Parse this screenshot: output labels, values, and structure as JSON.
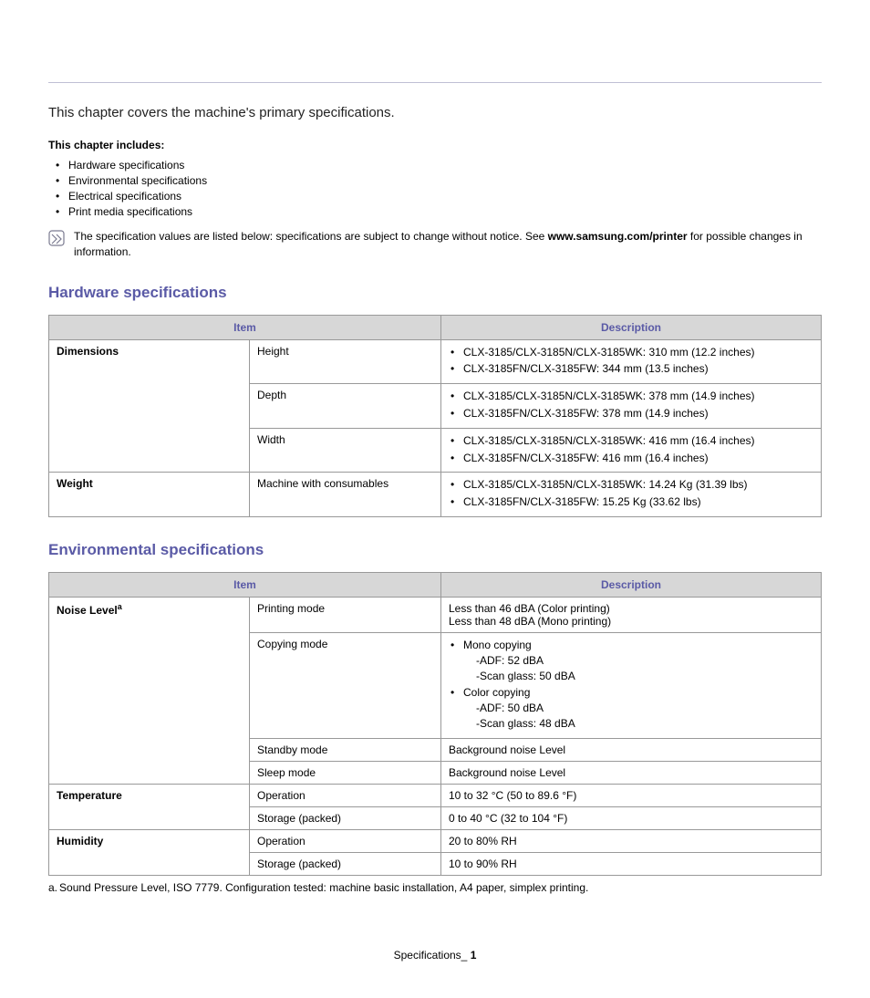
{
  "intro": "This chapter covers the machine's primary specifications.",
  "includes_label": "This chapter includes:",
  "includes": [
    "Hardware specifications",
    "Environmental specifications",
    "Electrical specifications",
    "Print media specifications"
  ],
  "note": {
    "prefix": "The specification values are listed below: specifications are subject to change without notice. See ",
    "link": "www.samsung.com/printer",
    "suffix": " for possible changes in information."
  },
  "table_head": {
    "item": "Item",
    "desc": "Description"
  },
  "hardware": {
    "heading": "Hardware specifications",
    "rows": {
      "dimensions_label": "Dimensions",
      "height_label": "Height",
      "height_v1": "CLX-3185/CLX-3185N/CLX-3185WK: 310 mm (12.2 inches)",
      "height_v2": "CLX-3185FN/CLX-3185FW: 344 mm (13.5 inches)",
      "depth_label": "Depth",
      "depth_v1": "CLX-3185/CLX-3185N/CLX-3185WK: 378 mm (14.9 inches)",
      "depth_v2": "CLX-3185FN/CLX-3185FW: 378 mm (14.9 inches)",
      "width_label": "Width",
      "width_v1": "CLX-3185/CLX-3185N/CLX-3185WK: 416 mm (16.4 inches)",
      "width_v2": "CLX-3185FN/CLX-3185FW: 416 mm (16.4 inches)",
      "weight_label": "Weight",
      "weight_sub": "Machine with consumables",
      "weight_v1": "CLX-3185/CLX-3185N/CLX-3185WK: 14.24 Kg (31.39 lbs)",
      "weight_v2": "CLX-3185FN/CLX-3185FW: 15.25 Kg (33.62 lbs)"
    }
  },
  "environmental": {
    "heading": "Environmental specifications",
    "rows": {
      "noise_label": "Noise Level",
      "noise_sup": "a",
      "print_label": "Printing mode",
      "print_v1": "Less than 46 dBA (Color printing)",
      "print_v2": "Less than 48 dBA (Mono printing)",
      "copy_label": "Copying mode",
      "copy_mono": "Mono copying",
      "copy_mono_adf": "-ADF: 52 dBA",
      "copy_mono_glass": "-Scan glass: 50 dBA",
      "copy_color": "Color copying",
      "copy_color_adf": "-ADF: 50 dBA",
      "copy_color_glass": "-Scan glass: 48 dBA",
      "standby_label": "Standby mode",
      "standby_v": "Background noise Level",
      "sleep_label": "Sleep mode",
      "sleep_v": "Background noise Level",
      "temp_label": "Temperature",
      "temp_op_label": "Operation",
      "temp_op_v": "10 to 32 °C (50 to 89.6 °F)",
      "temp_st_label": "Storage (packed)",
      "temp_st_v": "0 to 40 °C (32 to 104 °F)",
      "hum_label": "Humidity",
      "hum_op_label": "Operation",
      "hum_op_v": "20 to 80% RH",
      "hum_st_label": "Storage (packed)",
      "hum_st_v": "10 to 90% RH"
    },
    "footnote_mark": "a.",
    "footnote_text": "Sound Pressure Level, ISO 7779. Configuration tested: machine basic installation, A4 paper, simplex printing."
  },
  "footer": {
    "label": "Specifications_",
    "page": "1"
  }
}
